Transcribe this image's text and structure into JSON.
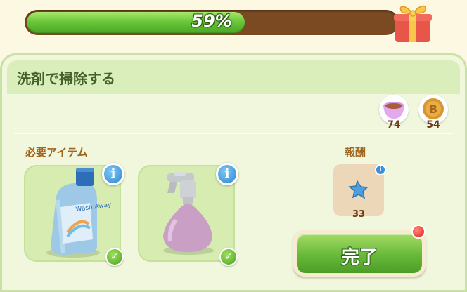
{
  "progress": {
    "percent": 59,
    "label": "59%"
  },
  "task": {
    "title": "洗剤で掃除する"
  },
  "currencies": [
    {
      "icon": "teacup-icon",
      "value": "74"
    },
    {
      "icon": "coin-icon",
      "value": "54"
    }
  ],
  "required": {
    "label": "必要アイテム",
    "items": [
      {
        "icon": "detergent-bottle-icon",
        "bottle_text": "Wash Away"
      },
      {
        "icon": "spray-bottle-icon"
      }
    ]
  },
  "reward": {
    "label": "報酬",
    "icon": "blue-star-icon",
    "count": "33"
  },
  "complete_button": {
    "label": "完了"
  },
  "colors": {
    "progress_green": "#6cc73a",
    "progress_track": "#7b4a22",
    "panel_bg": "#f1f7dc",
    "accent_brown": "#a06420"
  }
}
